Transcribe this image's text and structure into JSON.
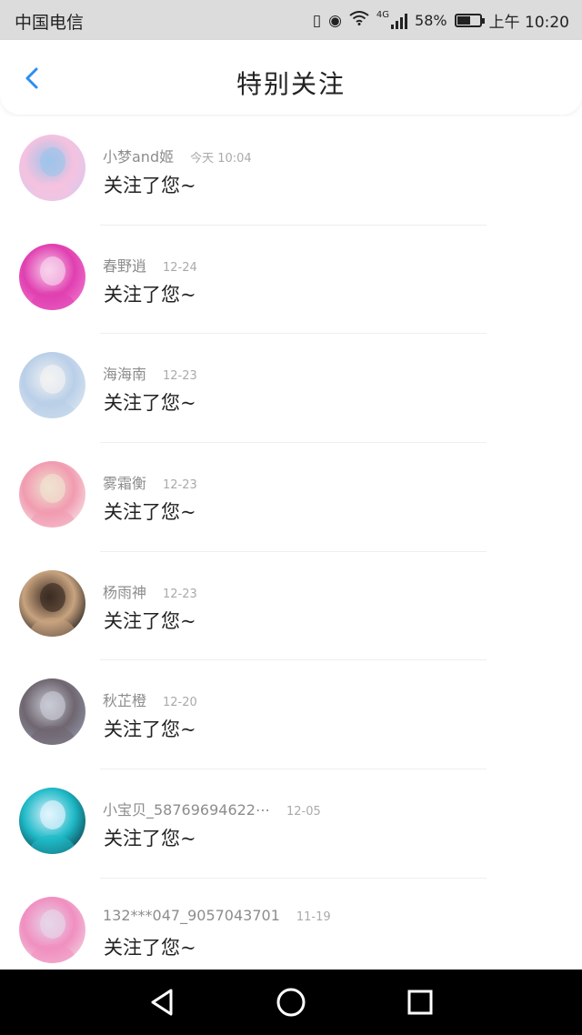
{
  "status_bar": {
    "carrier": "中国电信",
    "network_type": "4G",
    "battery": "58%",
    "battery_level": 0.58,
    "time": "上午 10:20"
  },
  "header": {
    "title": "特别关注",
    "back_icon": "chevron-left-icon"
  },
  "colors": {
    "accent": "#2a8df4",
    "status_bar_bg": "#dcdcdc",
    "nav_bar_bg": "#000000"
  },
  "items": [
    {
      "name": "小梦and姬",
      "time": "今天 10:04",
      "message": "关注了您~",
      "avatar_colors": [
        "#d9c9ef",
        "#f5c2df",
        "#9ec4ea"
      ]
    },
    {
      "name": "春野逍",
      "time": "12-24",
      "message": "关注了您~",
      "avatar_colors": [
        "#f07ad0",
        "#e03fb0",
        "#f8d2ec"
      ]
    },
    {
      "name": "海海南",
      "time": "12-23",
      "message": "关注了您~",
      "avatar_colors": [
        "#dfe7f1",
        "#b9cfe8",
        "#f2f2f2"
      ]
    },
    {
      "name": "雾霜衡",
      "time": "12-23",
      "message": "关注了您~",
      "avatar_colors": [
        "#f6e4e8",
        "#f19bb0",
        "#f0e2cf"
      ]
    },
    {
      "name": "杨雨神",
      "time": "12-23",
      "message": "关注了您~",
      "avatar_colors": [
        "#151515",
        "#c8a37f",
        "#3a2b22"
      ]
    },
    {
      "name": "秋芷橙",
      "time": "12-20",
      "message": "关注了您~",
      "avatar_colors": [
        "#9296aa",
        "#6f6670",
        "#c9cbd6"
      ]
    },
    {
      "name": "小宝贝_58769694622⋯",
      "time": "12-05",
      "message": "关注了您~",
      "avatar_colors": [
        "#0b3b46",
        "#1fb9c7",
        "#e2f5ff"
      ]
    },
    {
      "name": "132***047_9057043701",
      "time": "11-19",
      "message": "关注了您~",
      "avatar_colors": [
        "#f2cfe0",
        "#f08fc0",
        "#e6d6ea"
      ]
    }
  ],
  "nav_bar": {
    "back": "triangle-back-icon",
    "home": "circle-home-icon",
    "recents": "square-recents-icon"
  }
}
